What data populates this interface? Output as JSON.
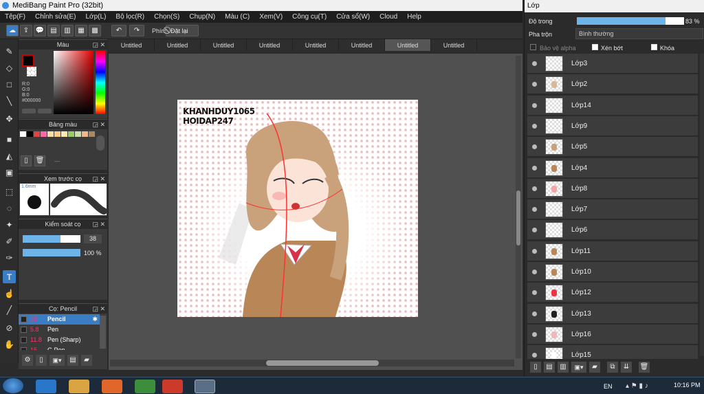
{
  "app": {
    "title": "MediBang Paint Pro (32bit)"
  },
  "menu": [
    "Tệp(F)",
    "Chỉnh sửa(E)",
    "Lớp(L)",
    "Bộ lọc(R)",
    "Chọn(S)",
    "Chụp(N)",
    "Màu (C)",
    "Xem(V)",
    "Công cụ(T)",
    "Cửa sổ(W)",
    "Cloud",
    "Help"
  ],
  "toolbar": {
    "shortcut_label": "Phím",
    "reset_label": "Đặt lại"
  },
  "tabs": [
    "Untitled",
    "Untitled",
    "Untitled",
    "Untitled",
    "Untitled",
    "Untitled",
    "Untitled",
    "Untitled"
  ],
  "active_tab_index": 6,
  "color_panel": {
    "title": "Màu",
    "r": "R:0",
    "g": "G:0",
    "b": "B:0",
    "hex": "#000000"
  },
  "palette_panel": {
    "title": "Bảng màu",
    "dash": "---",
    "swatches": [
      "#ffffff",
      "#000000",
      "#d44",
      "#f6a",
      "#fda",
      "#fc8",
      "#ffe9b0",
      "#9c6",
      "#cda",
      "#eb8",
      "#a86"
    ]
  },
  "brush_preview": {
    "title": "Xem trước cọ",
    "size": "1.6mm"
  },
  "brush_control": {
    "title": "Kiểm soát cọ",
    "size_value": "38",
    "opacity_value": "100 %",
    "size_fraction": 0.66,
    "opacity_fraction": 1.0
  },
  "brush_list": {
    "title": "Cọ: Pencil",
    "items": [
      {
        "size": "38",
        "name": "Pencil",
        "selected": true
      },
      {
        "size": "5.8",
        "name": "Pen",
        "selected": false
      },
      {
        "size": "11.8",
        "name": "Pen (Sharp)",
        "selected": false
      },
      {
        "size": "15",
        "name": "G Pen",
        "selected": false
      }
    ]
  },
  "canvas": {
    "watermark_line1": "KHANHDUY1065",
    "watermark_line2": "HOIDAP247"
  },
  "layers_panel": {
    "title": "Lớp",
    "opacity_label": "Độ trong",
    "opacity_value": "83 %",
    "opacity_fraction": 0.83,
    "blend_label": "Pha trộn",
    "blend_value": "Bình thường",
    "protect_alpha": "Bảo vệ alpha",
    "clipping": "Xén bớt",
    "lock": "Khóa",
    "layers": [
      "Lớp3",
      "Lớp2",
      "Lớp14",
      "Lớp9",
      "Lớp5",
      "Lớp4",
      "Lớp8",
      "Lớp7",
      "Lớp6",
      "Lớp11",
      "Lớp10",
      "Lớp12",
      "Lớp13",
      "Lớp16",
      "Lớp15"
    ]
  },
  "taskbar": {
    "lang": "EN",
    "time": "10:16 PM"
  }
}
